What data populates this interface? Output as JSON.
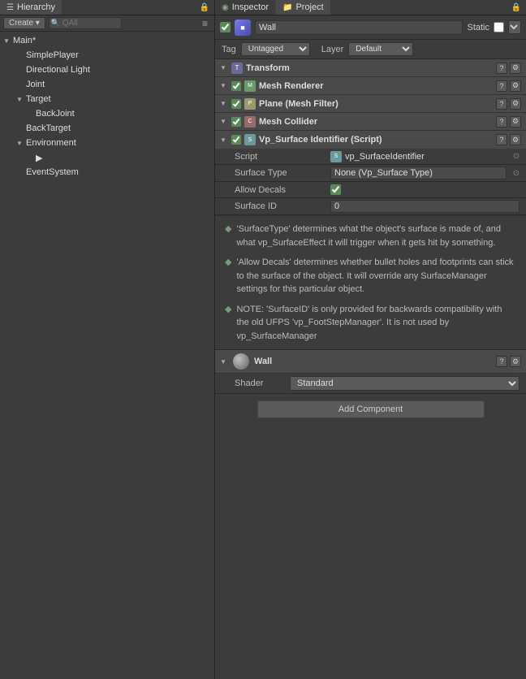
{
  "hierarchy": {
    "title": "Hierarchy",
    "create_label": "Create",
    "search_placeholder": "QAll",
    "items": [
      {
        "id": "main",
        "label": "Main*",
        "indent": 0,
        "expanded": true,
        "has_children": true
      },
      {
        "id": "simple-player",
        "label": "SimplePlayer",
        "indent": 1,
        "expanded": false,
        "has_children": false
      },
      {
        "id": "directional-light",
        "label": "Directional Light",
        "indent": 1,
        "expanded": false,
        "has_children": false
      },
      {
        "id": "joint",
        "label": "Joint",
        "indent": 1,
        "expanded": false,
        "has_children": false
      },
      {
        "id": "target",
        "label": "Target",
        "indent": 1,
        "expanded": true,
        "has_children": true
      },
      {
        "id": "back-joint",
        "label": "BackJoint",
        "indent": 2,
        "expanded": false,
        "has_children": false
      },
      {
        "id": "back-target",
        "label": "BackTarget",
        "indent": 1,
        "expanded": false,
        "has_children": false
      },
      {
        "id": "environment",
        "label": "Environment",
        "indent": 1,
        "expanded": true,
        "has_children": true
      },
      {
        "id": "cursor",
        "label": "",
        "indent": 2,
        "expanded": false,
        "has_children": false
      },
      {
        "id": "event-system",
        "label": "EventSystem",
        "indent": 1,
        "expanded": false,
        "has_children": false
      }
    ]
  },
  "inspector": {
    "title": "Inspector",
    "project_label": "Project",
    "object_name": "Wall",
    "object_checked": true,
    "static_label": "Static",
    "static_checked": false,
    "tag_label": "Tag",
    "tag_value": "Untagged",
    "layer_label": "Layer",
    "layer_value": "Default",
    "components": [
      {
        "id": "transform",
        "label": "Transform",
        "type": "transform",
        "expanded": true,
        "has_checkbox": false
      },
      {
        "id": "mesh-renderer",
        "label": "Mesh Renderer",
        "type": "mesh-renderer",
        "expanded": true,
        "has_checkbox": true,
        "checked": true
      },
      {
        "id": "plane-mesh-filter",
        "label": "Plane (Mesh Filter)",
        "type": "plane",
        "expanded": true,
        "has_checkbox": false
      },
      {
        "id": "mesh-collider",
        "label": "Mesh Collider",
        "type": "collider",
        "expanded": true,
        "has_checkbox": true,
        "checked": true
      }
    ],
    "script_component": {
      "label": "Vp_Surface Identifier (Script)",
      "type": "script",
      "expanded": true,
      "has_checkbox": true,
      "checked": true,
      "properties": [
        {
          "label": "Script",
          "value": "vp_SurfaceIdentifier",
          "type": "text"
        },
        {
          "label": "Surface Type",
          "value": "None (Vp_Surface Type)",
          "type": "text"
        },
        {
          "label": "Allow Decals",
          "value": "",
          "type": "checkbox",
          "checked": true
        },
        {
          "label": "Surface ID",
          "value": "0",
          "type": "text"
        }
      ],
      "info_text": [
        {
          "icon": "◆",
          "text": "'SurfaceType' determines what the object's surface is made of, and what vp_SurfaceEffect it will trigger when it gets hit by something."
        },
        {
          "icon": "◆",
          "text": "'Allow Decals' determines whether bullet holes and footprints can stick to the surface of the object. It will override any SurfaceManager settings for this particular object."
        },
        {
          "icon": "◆",
          "text": "NOTE: 'SurfaceID' is only provided for backwards compatibility with the old UFPS 'vp_FootStepManager'. It is not used by vp_SurfaceManager"
        }
      ]
    },
    "material": {
      "name": "Wall",
      "shader_label": "Shader",
      "shader_value": "Standard"
    },
    "add_component_label": "Add Component"
  },
  "icons": {
    "transform_char": "T",
    "mesh_char": "M",
    "plane_char": "P",
    "collider_char": "C",
    "script_char": "S",
    "settings_char": "⚙",
    "docs_char": "?"
  }
}
